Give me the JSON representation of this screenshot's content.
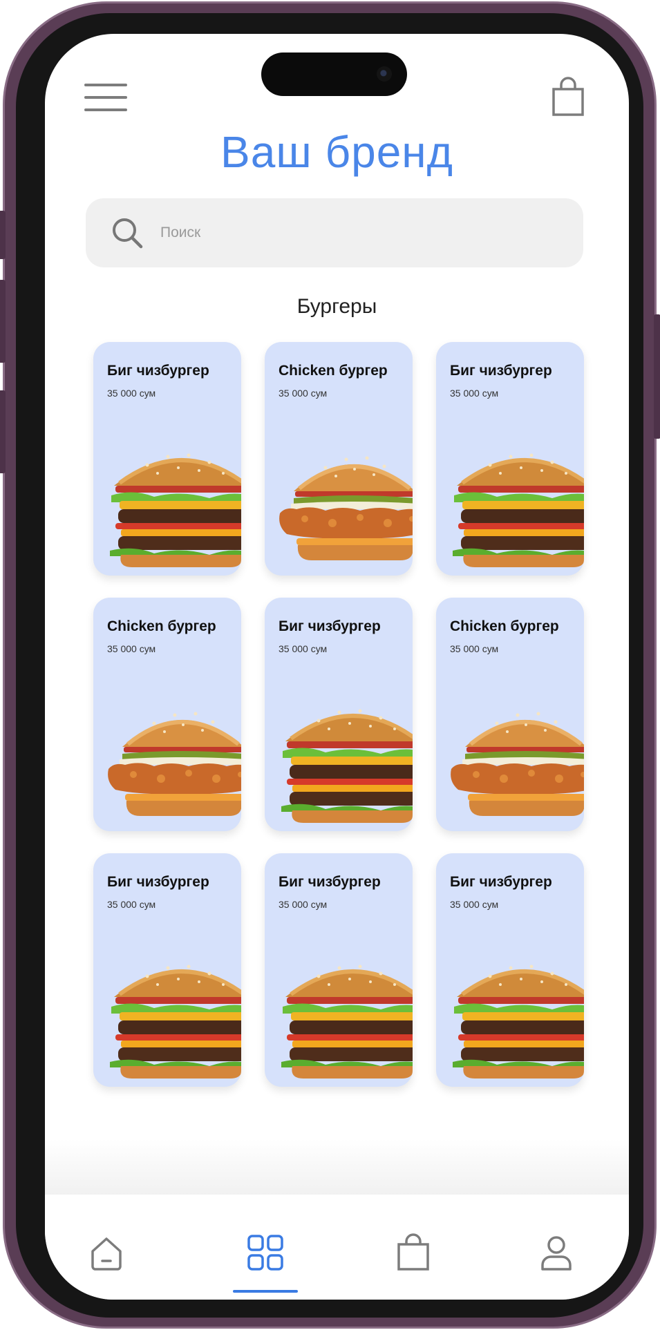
{
  "header": {
    "brand_title": "Ваш бренд",
    "menu_icon": "hamburger-menu-icon",
    "cart_icon": "shopping-bag-icon"
  },
  "search": {
    "placeholder": "Поиск",
    "icon": "search-icon"
  },
  "section": {
    "title": "Бургеры"
  },
  "products": [
    {
      "name": "Биг чизбургер",
      "price": "35 000 сум",
      "image": "cheeseburger"
    },
    {
      "name": "Chicken бургер",
      "price": "35 000 сум",
      "image": "chicken-burger"
    },
    {
      "name": "Биг чизбургер",
      "price": "35 000 сум",
      "image": "cheeseburger"
    },
    {
      "name": "Chicken бургер",
      "price": "35 000 сум",
      "image": "chicken-burger"
    },
    {
      "name": "Биг чизбургер",
      "price": "35 000 сум",
      "image": "cheeseburger"
    },
    {
      "name": "Chicken бургер",
      "price": "35 000 сум",
      "image": "chicken-burger"
    },
    {
      "name": "Биг чизбургер",
      "price": "35 000 сум",
      "image": "cheeseburger"
    },
    {
      "name": "Биг чизбургер",
      "price": "35 000 сум",
      "image": "cheeseburger"
    },
    {
      "name": "Биг чизбургер",
      "price": "35 000 сум",
      "image": "cheeseburger"
    }
  ],
  "tabbar": {
    "tabs": [
      "home-icon",
      "grid-icon",
      "shopping-bag-icon",
      "profile-icon"
    ],
    "active_tab": "grid-icon"
  },
  "colors": {
    "brand": "#4a86e8",
    "card_bg": "#d6e1fb",
    "active_indicator": "#3a7be3",
    "phone_frame": "#5a3d55"
  }
}
